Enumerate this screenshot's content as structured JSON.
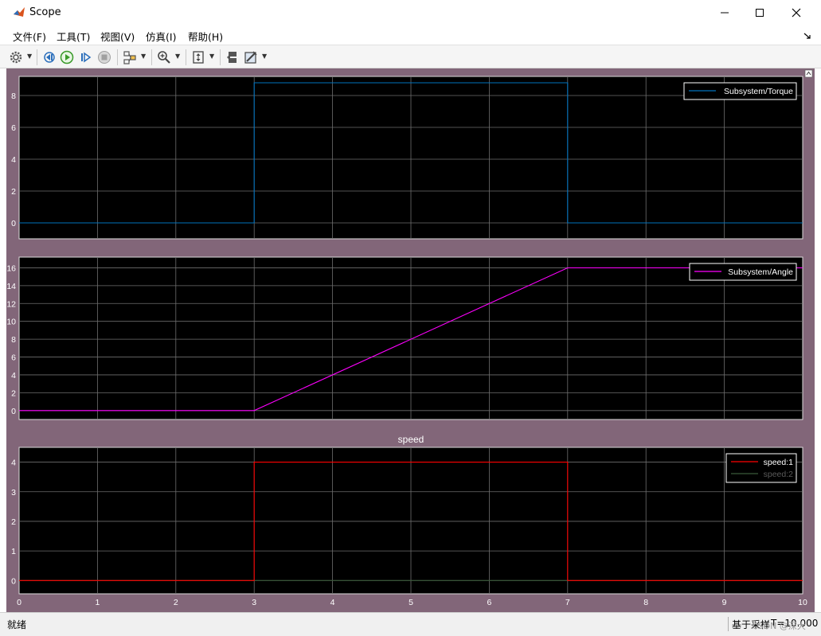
{
  "window": {
    "title": "Scope"
  },
  "menu": [
    {
      "label": "文件(F)"
    },
    {
      "label": "工具(T)"
    },
    {
      "label": "视图(V)"
    },
    {
      "label": "仿真(I)"
    },
    {
      "label": "帮助(H)"
    }
  ],
  "toolbar": {
    "icons": [
      "settings-icon",
      "step-back-icon",
      "run-icon",
      "step-forward-icon",
      "stop-icon",
      "highlight-icon",
      "zoom-icon",
      "autoscale-icon",
      "layout-icon",
      "style-icon"
    ]
  },
  "status": {
    "left": "就绪",
    "mode": "基于采样",
    "time": "T=10.000"
  },
  "watermark": "CSDN @深大",
  "colors": {
    "plot_bg": "#000000",
    "figure_bg": "#826679",
    "torque": "#0072bd",
    "angle": "#ff00ff",
    "speed1": "#ff0000",
    "speed2": "#3a5a3a",
    "grid": "#ffffff"
  },
  "chart_data": [
    {
      "type": "line",
      "title": "",
      "xlim": [
        0,
        10
      ],
      "ylim": [
        -1,
        9.2
      ],
      "xticks": [],
      "yticks": [
        "0",
        "2",
        "4",
        "6",
        "8"
      ],
      "legend": "top-right",
      "grid": true,
      "series": [
        {
          "name": "Subsystem/Torque",
          "color": "#0072bd",
          "x": [
            0,
            3,
            3,
            7,
            7,
            10
          ],
          "y": [
            0,
            0,
            8.8,
            8.8,
            0,
            0
          ]
        }
      ]
    },
    {
      "type": "line",
      "title": "",
      "xlim": [
        0,
        10
      ],
      "ylim": [
        -1,
        17.2
      ],
      "xticks": [],
      "yticks": [
        "0",
        "2",
        "4",
        "6",
        "8",
        "10",
        "12",
        "14",
        "16"
      ],
      "legend": "top-right",
      "grid": true,
      "series": [
        {
          "name": "Subsystem/Angle",
          "color": "#ff00ff",
          "x": [
            0,
            3,
            7,
            10
          ],
          "y": [
            0,
            0,
            16,
            16
          ]
        }
      ]
    },
    {
      "type": "line",
      "title": "speed",
      "xlim": [
        0,
        10
      ],
      "ylim": [
        -0.45,
        4.5
      ],
      "xticks": [
        "0",
        "1",
        "2",
        "3",
        "4",
        "5",
        "6",
        "7",
        "8",
        "9",
        "10"
      ],
      "yticks": [
        "0",
        "1",
        "2",
        "3",
        "4"
      ],
      "legend": "top-right",
      "grid": true,
      "series": [
        {
          "name": "speed:1",
          "color": "#ff0000",
          "x": [
            0,
            3,
            3,
            7,
            7,
            10
          ],
          "y": [
            0,
            0,
            4,
            4,
            0,
            0
          ]
        },
        {
          "name": "speed:2",
          "color": "#3a5a3a",
          "x": [
            0,
            10
          ],
          "y": [
            0,
            0
          ]
        }
      ]
    }
  ]
}
